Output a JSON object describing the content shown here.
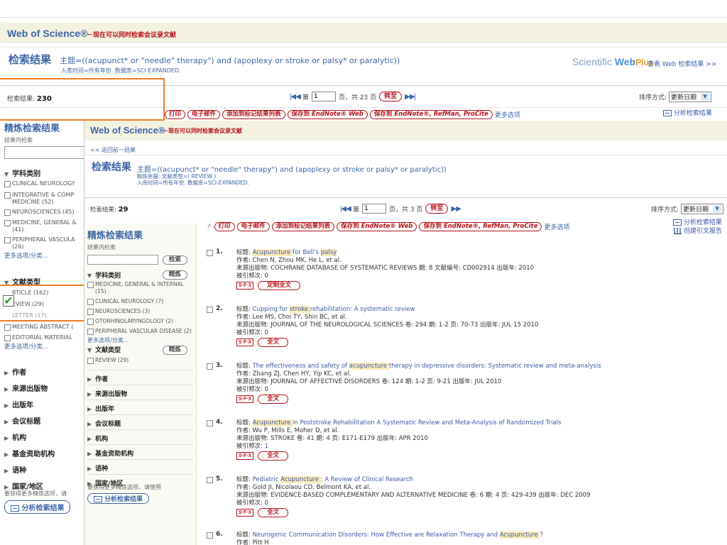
{
  "background": {
    "header": {
      "title": "Web of Science®",
      "subtitle": "－现在可以同时检索会议录文献"
    },
    "search": {
      "label": "检索结果",
      "topic": "主题=((acupunct* or \"needle\" therapy\") and (apoplexy or stroke or palsy* or paralytic))",
      "meta": "入库时间=所有年份. 数据库=SCI-EXPANDED."
    },
    "sci_webplus": {
      "logo_a": "Scientific ",
      "logo_b": "Web",
      "logo_c": "Plus",
      "link": "查看 Web 检索结果 >>"
    },
    "count": {
      "label": "检索结果:",
      "value": "230"
    },
    "pager": {
      "prefix": "第",
      "page": "1",
      "suffix": "页，共 23 页",
      "go": "转至"
    },
    "sort": {
      "label": "排序方式:",
      "value": "更新日期"
    },
    "toolbar": {
      "print": "打印",
      "email": "电子邮件",
      "marked": "添加到标记结果列表",
      "save_endnote_web_a": "保存到",
      "save_endnote_web_b": "EndNote® Web",
      "save_endnote_a": "保存到",
      "save_endnote_b": "EndNote®, RefMan, ProCite",
      "more": "更多选项"
    },
    "analyze": "分析检索结果",
    "refine": {
      "title": "精炼检索结果",
      "within": "结果内检索",
      "subject_header": "学科类别",
      "subjects": [
        "CLINICAL NEUROLOGY",
        "INTEGRATIVE & COMP",
        "MEDICINE (52)",
        "NEUROSCIENCES (45)",
        "MEDICINE, GENERAL &",
        "(41)",
        "PERIPHERAL VASCULA",
        "(26)"
      ],
      "more1": "更多选项/分类...",
      "doctype_header": "文献类型",
      "doctypes": [
        "RTICLE (162)",
        "EVIEW (29)",
        "LETTER (17)",
        "MEETING ABSTRACT (",
        "EDITORIAL MATERIAL"
      ],
      "more2": "更多选项/分类...",
      "sections": [
        "作者",
        "来源出版物",
        "出版年",
        "会议标题",
        "机构",
        "基金资助机构",
        "语种",
        "国家/地区"
      ],
      "hint": "要获得更多精炼选项，请",
      "analyze_btn": "分析检索结果"
    }
  },
  "overlay": {
    "header": {
      "title": "Web of Science®",
      "subtitle": "－现在可以同时检索会议录文献"
    },
    "back": "<< 返回前一结果",
    "search": {
      "label": "检索结果",
      "topic": "主题=((acupunct* or \"needle\" therapy\") and (apoplexy or stroke or palsy* or paralytic))",
      "refined": "精炼依据: 文献类型=( REVIEW )",
      "meta": "入库时间=所有年份. 数据库=SCI-EXPANDED."
    },
    "count": {
      "label": "检索结果:",
      "value": "29"
    },
    "pager": {
      "prefix": "第",
      "page": "1",
      "suffix": "页，共 3 页",
      "go": "转至"
    },
    "sort": {
      "label": "排序方式:",
      "value": "更新日期"
    },
    "toolbar": {
      "print": "打印",
      "email": "电子邮件",
      "marked": "添加到标记结果列表",
      "save_endnote_web_a": "保存到",
      "save_endnote_web_b": "EndNote® Web",
      "save_endnote_a": "保存到",
      "save_endnote_b": "EndNote®, RefMan, ProCite",
      "more": "更多选项"
    },
    "links": {
      "analyze": "分析检索结果",
      "citation": "创建引文报告"
    },
    "refine": {
      "title": "精炼检索结果",
      "within": "结果内检索",
      "search_btn": "检索",
      "subject_header": "学科类别",
      "refine_btn": "精炼",
      "subjects": [
        "MEDICINE, GENERAL & INTERNAL (15)",
        "CLINICAL NEUROLOGY (7)",
        "NEUROSCIENCES (3)",
        "OTORHINOLARYNGOLOGY (2)",
        "PERIPHERAL VASCULAR DISEASE (2)"
      ],
      "more": "更多选项/分类...",
      "doctype_header": "文献类型",
      "doctype_btn": "精炼",
      "doctypes": [
        "REVIEW (29)"
      ],
      "sections": [
        "作者",
        "来源出版物",
        "出版年",
        "会议标题",
        "机构",
        "基金资助机构",
        "语种",
        "国家/地区"
      ],
      "hint": "要获得更多精炼选项，请使用",
      "analyze_btn": "分析检索结果"
    },
    "results": [
      {
        "num": "1.",
        "title_label": "标题:",
        "title": [
          [
            "hl",
            "Acupuncture"
          ],
          [
            "",
            "for Bell's "
          ],
          [
            "hl",
            "palsy"
          ]
        ],
        "authors": "作者: Chen N, Zhou MK, He L, et al.",
        "source": "来源出版物: COCHRANE DATABASE OF SYSTEMATIC REVIEWS  期: 8 文献编号: CD002914  出版年: 2010",
        "cited_label": "被引频次:",
        "cited": "0",
        "button": "定制全文"
      },
      {
        "num": "2.",
        "title_label": "标题:",
        "title": [
          [
            "",
            "Cupping for "
          ],
          [
            "hl",
            "stroke"
          ],
          [
            "",
            "rehabilitation: A systematic review"
          ]
        ],
        "authors": "作者: Lee MS, Choi TY, Shin BC, et al.",
        "source": "来源出版物: JOURNAL OF THE NEUROLOGICAL SCIENCES  卷: 294  期: 1-2  页: 70-73  出版年: JUL 15 2010",
        "cited_label": "被引频次:",
        "cited": "0",
        "button": "全文"
      },
      {
        "num": "3.",
        "title_label": "标题:",
        "title": [
          [
            "",
            "The effectiveness and safety of "
          ],
          [
            "hl",
            "acupuncture"
          ],
          [
            "",
            "therapy in depressive disorders: Systematic review and meta-analysis"
          ]
        ],
        "authors": "作者: Zhang ZJ, Chen HY, Yip KC, et al.",
        "source": "来源出版物: JOURNAL OF AFFECTIVE DISORDERS  卷: 124  期: 1-2  页: 9-21  出版年: JUL 2010",
        "cited_label": "被引频次:",
        "cited": "0",
        "button": "全文"
      },
      {
        "num": "4.",
        "title_label": "标题:",
        "title": [
          [
            "hl",
            "Acupuncture"
          ],
          [
            "",
            "in Poststroke Rehabilitation A Systematic Review and Meta-Analysis of Randomized Trials"
          ]
        ],
        "authors": "作者: Wu P, Mills E, Moher D, et al.",
        "source": "来源出版物: STROKE  卷: 41  期: 4  页: E171-E179  出版年: APR 2010",
        "cited_label": "被引频次:",
        "cited": "1",
        "button": "全文"
      },
      {
        "num": "5.",
        "title_label": "标题:",
        "title": [
          [
            "",
            "Pediatric "
          ],
          [
            "hl",
            "Acupuncture"
          ],
          [
            "",
            ": A Review of Clinical Research"
          ]
        ],
        "authors": "作者: Gold JI, Nicolaou CD, Belmont KA, et al.",
        "source": "来源出版物: EVIDENCE-BASED COMPLEMENTARY AND ALTERNATIVE MEDICINE  卷: 6  期: 4  页: 429-439  出版年: DEC 2009",
        "cited_label": "被引频次:",
        "cited": "0",
        "button": "全文"
      },
      {
        "num": "6.",
        "title_label": "标题:",
        "title": [
          [
            "",
            "Neurogenic Communication Disorders: How Effective are Relaxation Therapy and "
          ],
          [
            "hl",
            "Acupuncture"
          ],
          [
            "",
            "?"
          ]
        ],
        "authors": "作者: Pitt H",
        "source": "",
        "cited_label": "",
        "cited": "",
        "button": ""
      }
    ]
  },
  "colors": {
    "accent_blue": "#3e65a6",
    "brand_red": "#b5121b",
    "highlight": "#fbe9b6",
    "callout_orange": "#ef7d22"
  }
}
